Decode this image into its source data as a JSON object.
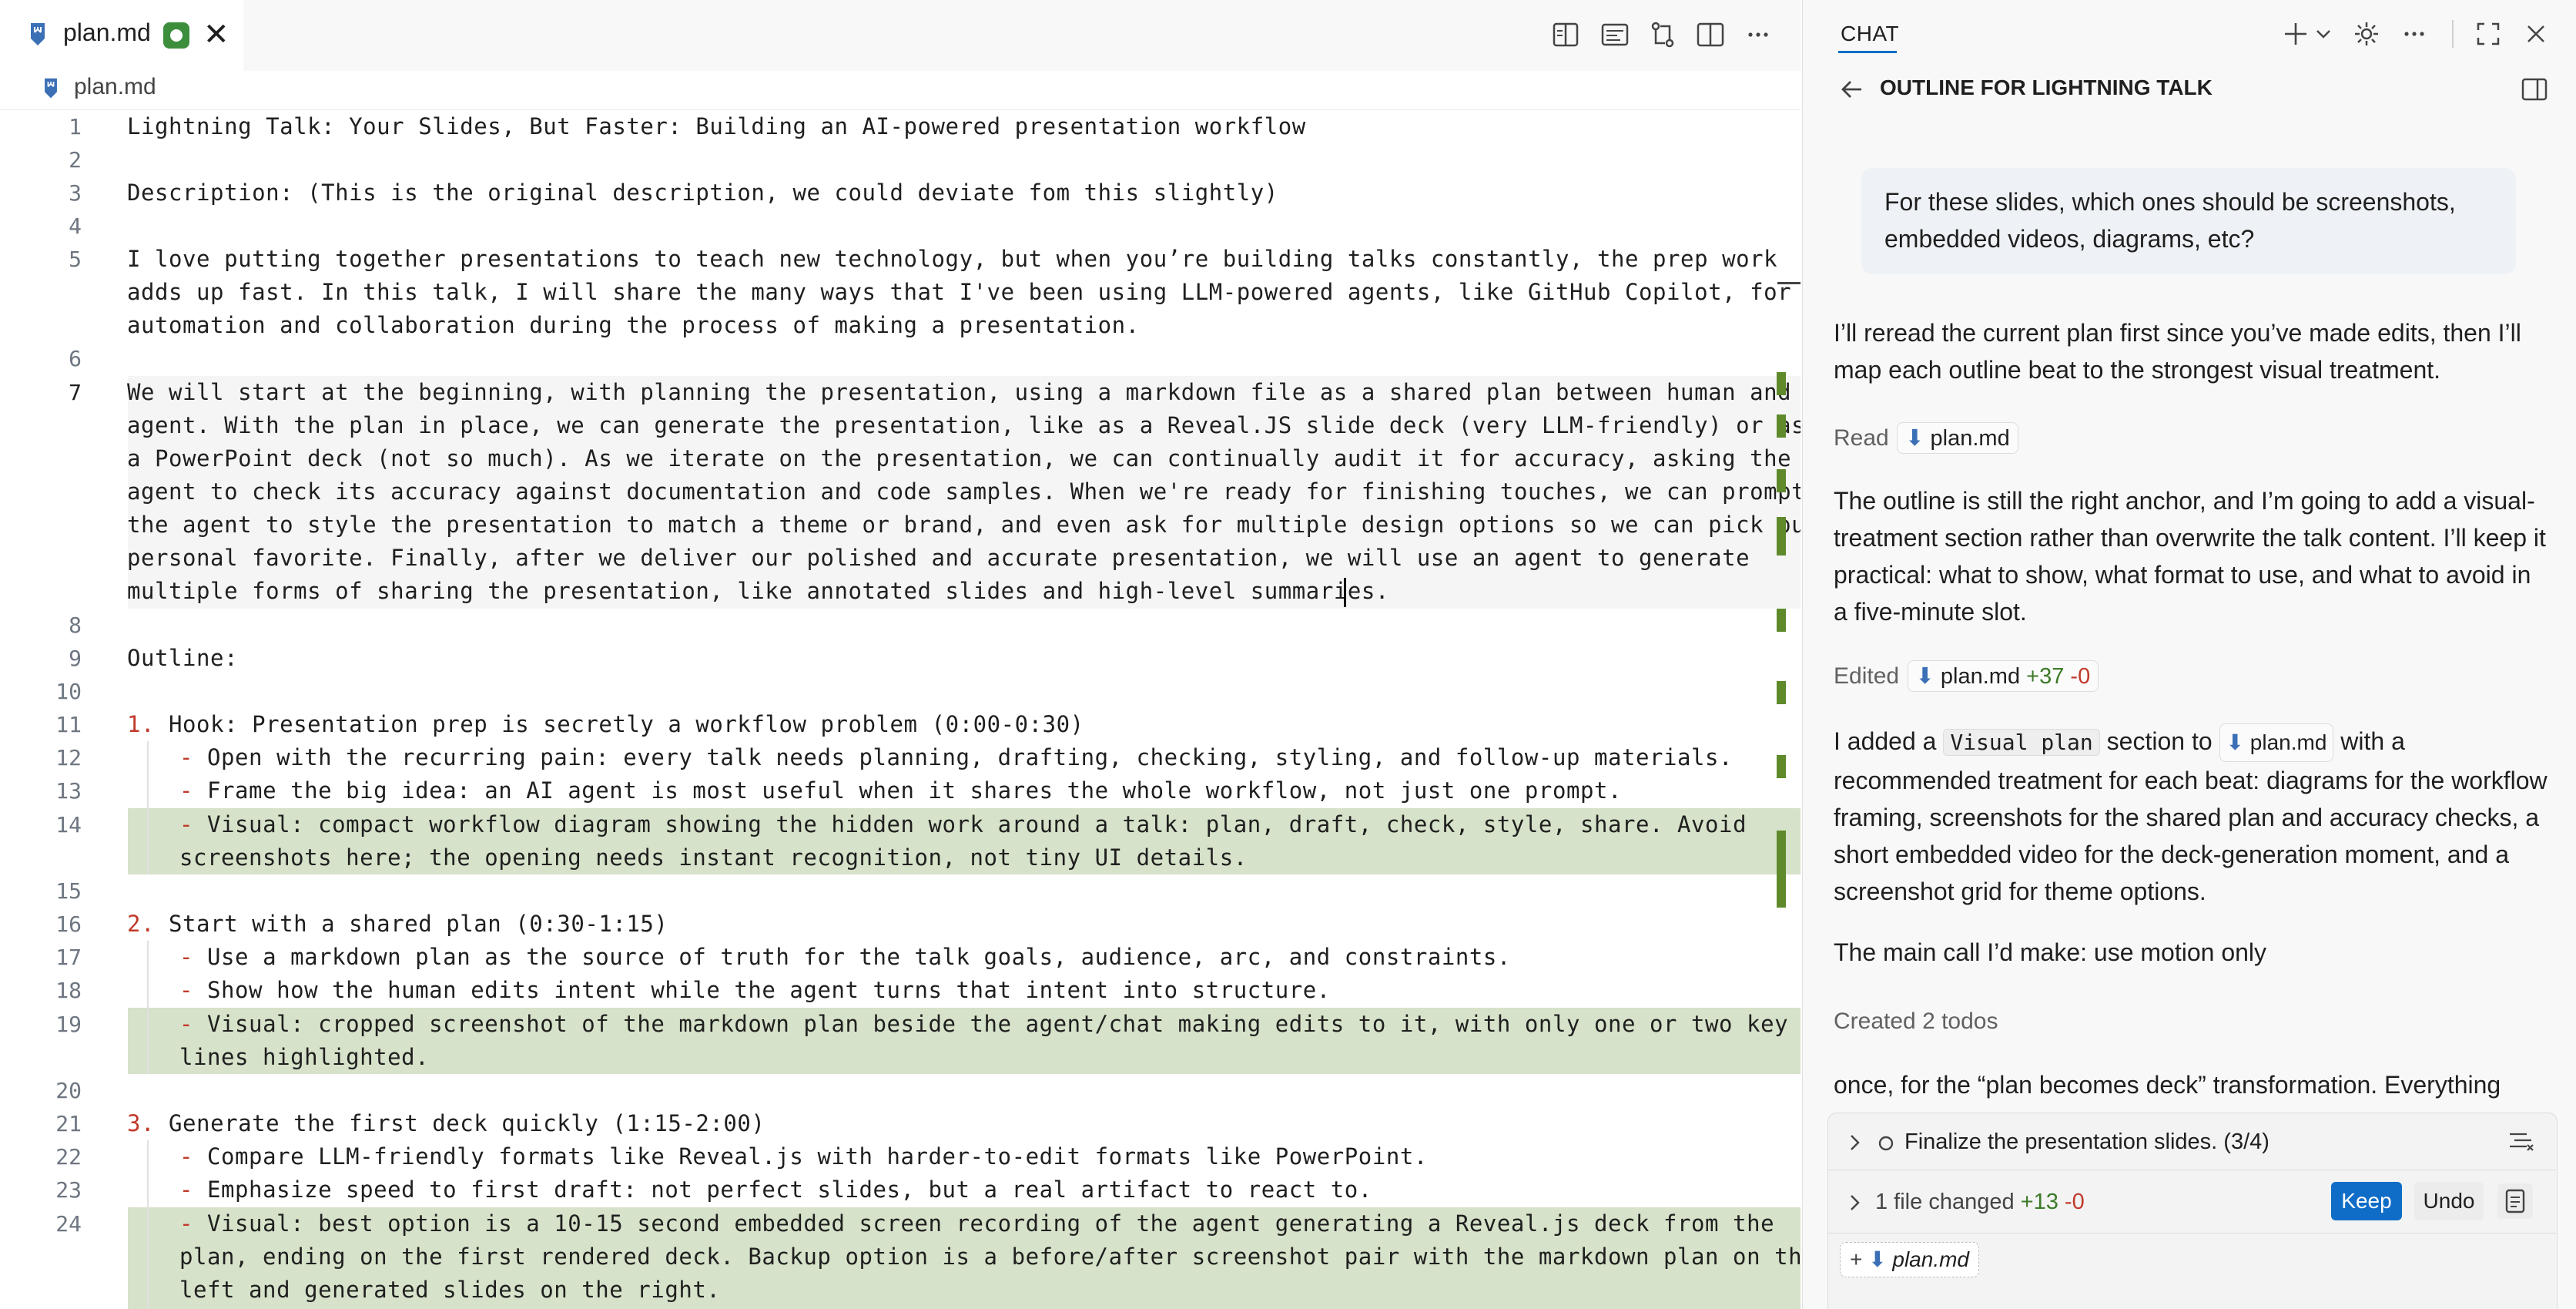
{
  "editor": {
    "tab": {
      "file_name": "plan.md",
      "close_glyph": "✕"
    },
    "breadcrumb": "plan.md",
    "actions": [
      "split-diff-icon",
      "preview-icon",
      "compare-changes-icon",
      "split-editor-icon",
      "more-icon"
    ],
    "line_numbers": [
      "1",
      "2",
      "3",
      "4",
      "5",
      "6",
      "7",
      "8",
      "9",
      "10",
      "11",
      "12",
      "13",
      "14",
      "15",
      "16",
      "17",
      "18",
      "19",
      "20",
      "21",
      "22",
      "23",
      "24"
    ],
    "lines": {
      "l1": "Lightning Talk: Your Slides, But Faster: Building an AI-powered presentation workflow",
      "l3": "Description: (This is the original description, we could deviate fom this slightly)",
      "l5a": "I love putting together presentations to teach new technology, but when you’re building talks constantly, the prep work",
      "l5b": "adds up fast. In this talk, I will share the many ways that I've been using LLM-powered agents, like GitHub Copilot, for",
      "l5c": "automation and collaboration during the process of making a presentation.",
      "l7a": "We will start at the beginning, with planning the presentation, using a markdown file as a shared plan between human and",
      "l7b": "agent. With the plan in place, we can generate the presentation, like as a Reveal.JS slide deck (very LLM-friendly) or as",
      "l7c": "a PowerPoint deck (not so much). As we iterate on the presentation, we can continually audit it for accuracy, asking the",
      "l7d": "agent to check its accuracy against documentation and code samples. When we're ready for finishing touches, we can prompt",
      "l7e": "the agent to style the presentation to match a theme or brand, and even ask for multiple design options so we can pick our",
      "l7f": "personal favorite. Finally, after we deliver our polished and accurate presentation, we will use an agent to generate",
      "l7g": "multiple forms of sharing the presentation, like annotated slides and high-level summaries.",
      "l9": "Outline:",
      "l11_num": "1.",
      "l11": " Hook: Presentation prep is secretly a workflow problem (0:00-0:30)",
      "l12": " Open with the recurring pain: every talk needs planning, drafting, checking, styling, and follow-up materials.",
      "l13": " Frame the big idea: an AI agent is most useful when it shares the whole workflow, not just one prompt.",
      "l14a": " Visual: compact workflow diagram showing the hidden work around a talk: plan, draft, check, style, share. Avoid",
      "l14b": "screenshots here; the opening needs instant recognition, not tiny UI details.",
      "l16_num": "2.",
      "l16": " Start with a shared plan (0:30-1:15)",
      "l17": " Use a markdown plan as the source of truth for the talk goals, audience, arc, and constraints.",
      "l18": " Show how the human edits intent while the agent turns that intent into structure.",
      "l19a": " Visual: cropped screenshot of the markdown plan beside the agent/chat making edits to it, with only one or two key",
      "l19b": "lines highlighted.",
      "l21_num": "3.",
      "l21": " Generate the first deck quickly (1:15-2:00)",
      "l22": " Compare LLM-friendly formats like Reveal.js with harder-to-edit formats like PowerPoint.",
      "l23": " Emphasize speed to first draft: not perfect slides, but a real artifact to react to.",
      "l24a": " Visual: best option is a 10-15 second embedded screen recording of the agent generating a Reveal.js deck from the",
      "l24b": "plan, ending on the first rendered deck. Backup option is a before/after screenshot pair with the markdown plan on the",
      "l24c": "left and generated slides on the right.",
      "dash": "-"
    }
  },
  "chat": {
    "header_label": "CHAT",
    "title": "OUTLINE FOR LIGHTNING TALK",
    "user_message": "For these slides, which ones should be screenshots, embedded videos, diagrams, etc?",
    "reply1": "I’ll reread the current plan first since you’ve made edits, then I’ll map each outline beat to the strongest visual treatment.",
    "read_label": "Read",
    "read_file": "plan.md",
    "reply2": "The outline is still the right anchor, and I’m going to add a visual-treatment section rather than overwrite the talk content. I’ll keep it practical: what to show, what format to use, and what to avoid in a five-minute slot.",
    "edited_label": "Edited",
    "edited_file": "plan.md",
    "edited_added": "+37",
    "edited_removed": "-0",
    "reply3_pre": "I added a",
    "reply3_code": "Visual plan",
    "reply3_mid": "section to",
    "reply3_file": "plan.md",
    "reply3_post": "with a recommended treatment for each beat: diagrams for the workflow framing, screenshots for the shared plan and accuracy checks, a short embedded video for the deck-generation moment, and a screenshot grid for theme options.",
    "reply4": "The main call I’d make: use motion only",
    "todos_label": "Created 2 todos",
    "reply5": "once, for the “plan becomes deck” transformation. Everything",
    "todo_item": "Finalize the presentation slides. (3/4)",
    "files_changed": "1 file changed",
    "files_added": "+13",
    "files_removed": "-0",
    "keep_label": "Keep",
    "undo_label": "Undo",
    "attached_file": "plan.md"
  }
}
